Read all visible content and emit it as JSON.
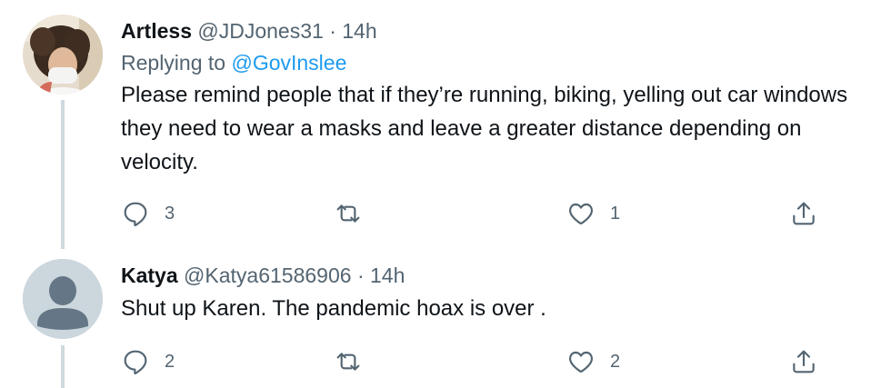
{
  "tweets": [
    {
      "name": "Artless",
      "handle": "@JDJones31",
      "separator": "·",
      "time": "14h",
      "replying_prefix": "Replying to",
      "replying_to": "@GovInslee",
      "text": "Please remind people that if they’re running, biking, yelling out car windows they need to wear a masks and leave a greater distance depending on velocity.",
      "replies": "3",
      "retweets": "",
      "likes": "1",
      "avatar": "photo-of-person-wearing-mask"
    },
    {
      "name": "Katya",
      "handle": "@Katya61586906",
      "separator": "·",
      "time": "14h",
      "text": "Shut up Karen. The pandemic hoax is over .",
      "replies": "2",
      "retweets": "",
      "likes": "2",
      "avatar": "default-profile-silhouette"
    }
  ],
  "icons": {
    "reply": "speech-bubble-icon",
    "retweet": "retweet-arrows-icon",
    "like": "heart-icon",
    "share": "share-upload-icon"
  },
  "colors": {
    "text": "#0f1419",
    "muted": "#536471",
    "link": "#1d9bf0",
    "thread_line": "#cfd9de",
    "default_avatar_bg": "#ccd6dd"
  }
}
